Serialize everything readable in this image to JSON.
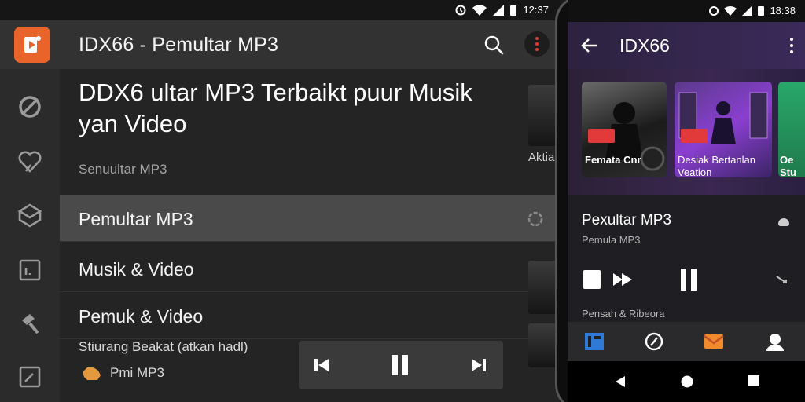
{
  "tablet": {
    "status_time": "12:37",
    "app_title": "IDX66 - Pemultar MP3",
    "hero_title": "DDX6 ultar MP3 Terbaikt puur Musik yan  Video",
    "hero_subtitle": "Senuultar MP3",
    "rows": [
      {
        "label": "Pemultar MP3",
        "selected": true
      },
      {
        "label": "Musik & Video",
        "selected": false
      },
      {
        "label": "Pemuk & Video",
        "selected": false
      }
    ],
    "strip_label": "Aktia",
    "footer_line": "Stiurang Beakat (atkan hadl)",
    "footer_sub": "Pmi MP3",
    "icons": {
      "logo": "play-logo-icon",
      "search": "search-icon",
      "more": "more-vert-icon",
      "nav": [
        "disc-icon",
        "heart-icon",
        "cube-icon",
        "chart-icon",
        "hammer-icon",
        "edit-icon"
      ],
      "row_action": "settings-icon",
      "miniplayer": [
        "skip-previous-icon",
        "pause-icon",
        "skip-next-icon"
      ]
    },
    "colors": {
      "accent": "#e8642a",
      "background": "#242425",
      "selected_row": "#4a4a4b"
    }
  },
  "phone": {
    "status_time": "18:38",
    "app_title": "IDX66",
    "albums": [
      {
        "caption": "Femata Cnr"
      },
      {
        "caption": "Desiak Bertanlan Veation"
      },
      {
        "caption": "Oe Stu"
      }
    ],
    "now_playing_title": "Pexultar MP3",
    "now_playing_subtitle": "Pemula MP3",
    "queue_label": "Pensah & Ribeora",
    "icons": {
      "back": "arrow-back-icon",
      "menu": "more-vert-icon",
      "controls": [
        "stop-icon",
        "fast-forward-icon",
        "pause-icon",
        "shuffle-icon"
      ],
      "bottom_nav": [
        "library-icon",
        "explore-icon",
        "mail-icon",
        "profile-icon"
      ],
      "system_nav": [
        "back-triangle-icon",
        "home-circle-icon",
        "recents-square-icon"
      ]
    },
    "colors": {
      "appbar": "#3b2a5a",
      "background": "#1f1e22"
    }
  }
}
